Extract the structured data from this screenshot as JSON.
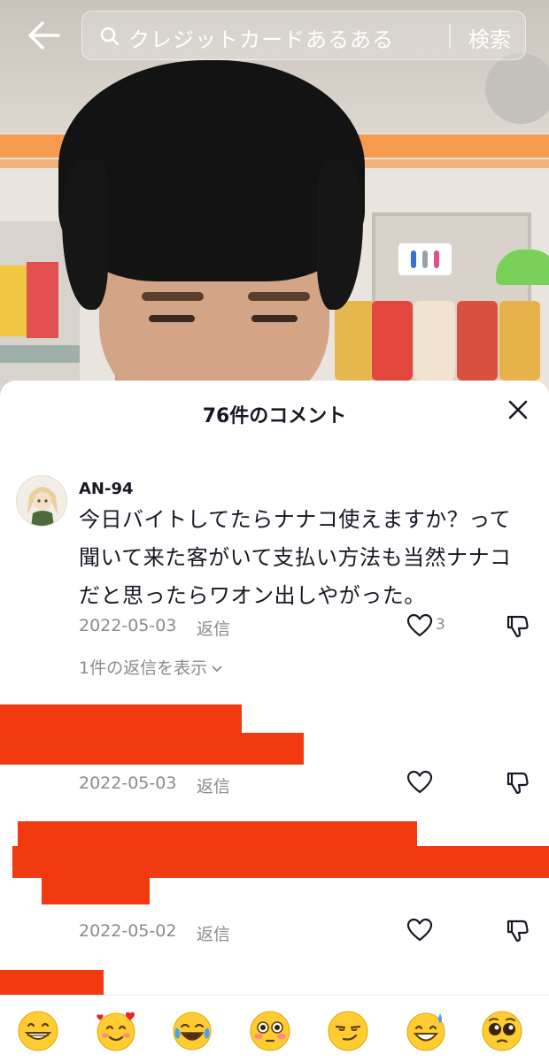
{
  "search": {
    "query": "クレジットカードあるある",
    "button_label": "検索"
  },
  "comments_sheet": {
    "title": "76件のコメント"
  },
  "comments": [
    {
      "username": "AN-94",
      "text_lines": [
        "今日バイトしてたらナナコ使えますか？って",
        "聞いて来た客がいて支払い方法も当然ナナコ",
        "だと思ったらワオン出しやがった。"
      ],
      "date": "2022-05-03",
      "reply_label": "返信",
      "like_count": "3",
      "view_replies_label": "1件の返信を表示"
    },
    {
      "date": "2022-05-03",
      "reply_label": "返信"
    },
    {
      "date": "2022-05-02",
      "reply_label": "返信"
    }
  ],
  "emoji_bar": {
    "emojis": [
      "😁",
      "🥰",
      "😂",
      "😳",
      "😏",
      "😅",
      "🥺"
    ]
  },
  "colors": {
    "redaction": "#f23a11",
    "meta_text": "#8a8b91",
    "primary_text": "#161823"
  }
}
